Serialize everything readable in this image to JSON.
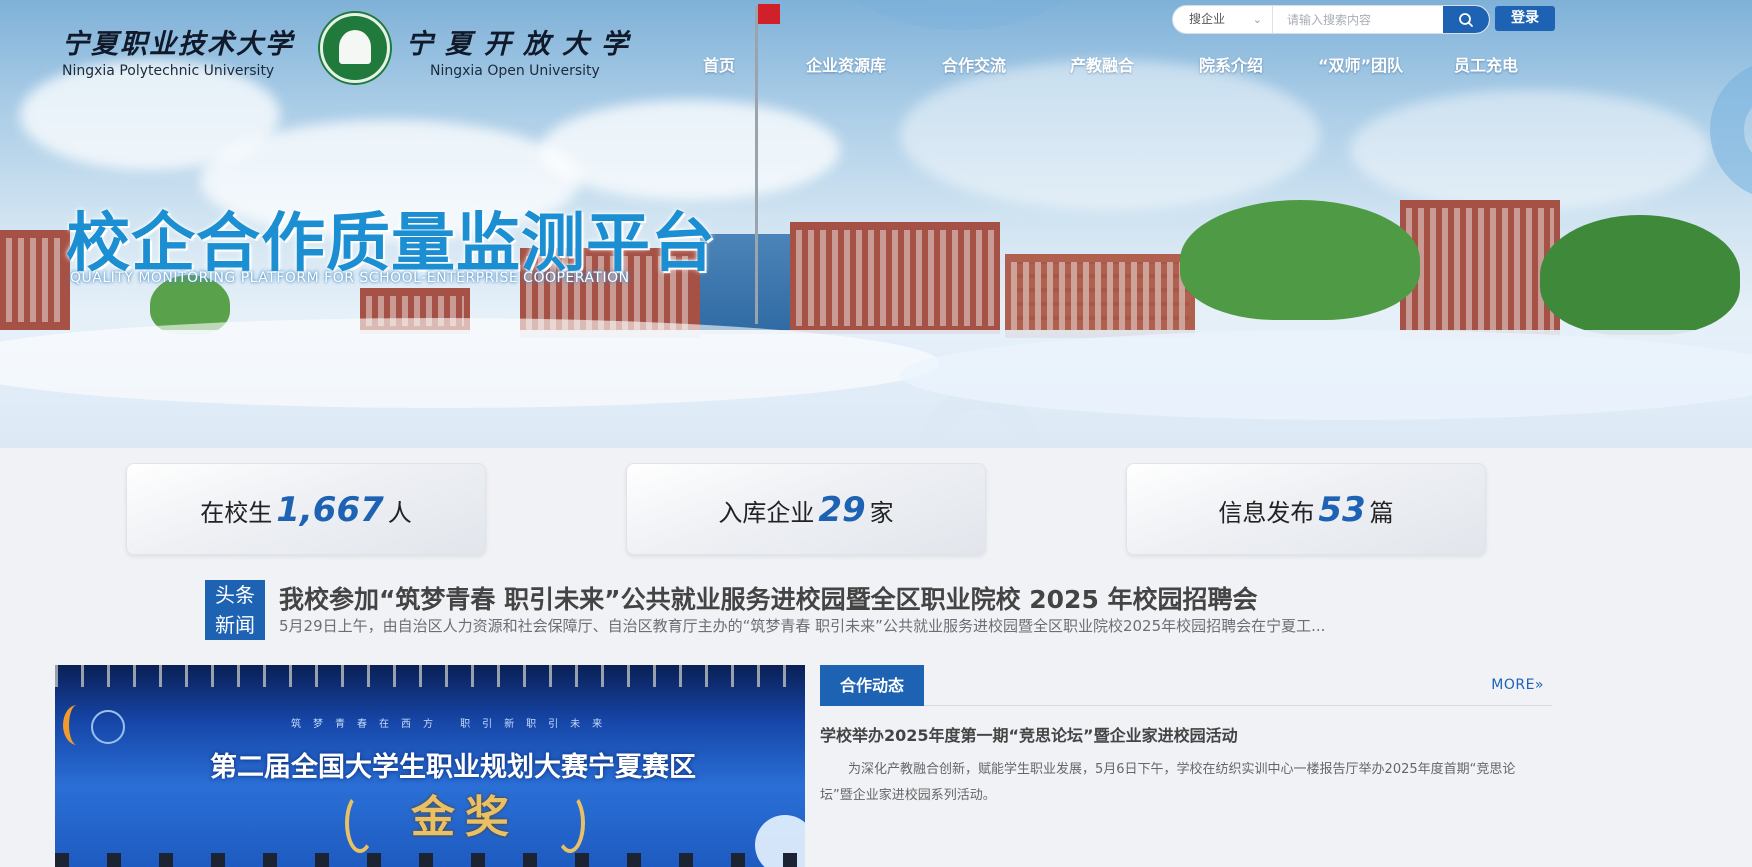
{
  "header": {
    "logo_np": {
      "cn": "宁夏职业技术大学",
      "en": "Ningxia Polytechnic University"
    },
    "logo_no": {
      "cn": "宁夏开放大学",
      "en": "Ningxia Open University"
    },
    "nav": [
      "首页",
      "企业资源库",
      "合作交流",
      "产教融合",
      "院系介绍",
      "“双师”团队",
      "员工充电"
    ],
    "search": {
      "category": "搜企业",
      "placeholder": "请输入搜索内容"
    },
    "login_label": "登录"
  },
  "hero": {
    "title": "校企合作质量监测平台",
    "subtitle": "QUALITY MONITORING PLATFORM FOR SCHOOL-ENTERPRISE COOPERATION"
  },
  "stats": [
    {
      "label": "在校生",
      "value": "1,667",
      "unit": "人"
    },
    {
      "label": "入库企业",
      "value": "29",
      "unit": "家"
    },
    {
      "label": "信息发布",
      "value": "53",
      "unit": "篇"
    }
  ],
  "headline": {
    "badge_line1": "头条",
    "badge_line2": "新闻",
    "title": "我校参加“筑梦青春 职引未来”公共就业服务进校园暨全区职业院校 2025 年校园招聘会",
    "summary": "5月29日上午，由自治区人力资源和社会保障厅、自治区教育厅主办的“筑梦青春 职引未来”公共就业服务进校园暨全区职业院校2025年校园招聘会在宁夏工..."
  },
  "photo": {
    "tagline": "筑梦青春在西方 职引新职引未来",
    "title": "第二届全国大学生职业规划大赛宁夏赛区",
    "award": "金奖"
  },
  "news": {
    "tab_label": "合作动态",
    "more_label": "MORE",
    "item_title": "学校举办2025年度第一期“竞思论坛”暨企业家进校园活动",
    "item_body": "为深化产教融合创新，赋能学生职业发展，5月6日下午，学校在纺织实训中心一楼报告厅举办2025年度首期“竞思论坛”暨企业家进校园系列活动。"
  },
  "colors": {
    "primary": "#1d62b3",
    "hero_title": "#1b8fd2",
    "background": "#f1f2f6"
  }
}
